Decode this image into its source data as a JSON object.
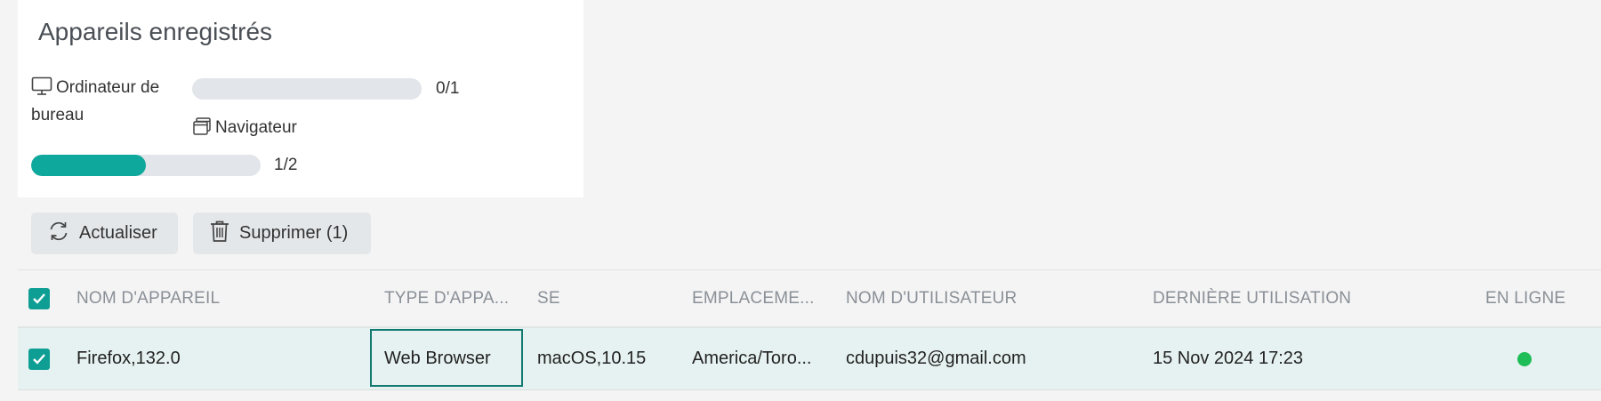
{
  "summary": {
    "title": "Appareils enregistrés",
    "desktop": {
      "label_line1": "Ordinateur de",
      "label_line2": "bureau",
      "count": "0/1",
      "progress": 0.0,
      "icon": "monitor-icon"
    },
    "browser": {
      "label": "Navigateur",
      "count": "1/2",
      "progress": 0.5,
      "icon": "browser-windows-icon"
    }
  },
  "toolbar": {
    "refresh_label": "Actualiser",
    "delete_label": "Supprimer (1)"
  },
  "table": {
    "columns": [
      "NOM D'APPAREIL",
      "TYPE D'APPA...",
      "SE",
      "EMPLACEME...",
      "NOM D'UTILISATEUR",
      "DERNIÈRE UTILISATION",
      "EN LIGNE"
    ],
    "rows": [
      {
        "checked": true,
        "device_name": "Firefox,132.0",
        "device_type": "Web Browser",
        "os": "macOS,10.15",
        "location": "America/Toro...",
        "username": "cdupuis32@gmail.com",
        "last_used": "15 Nov 2024 17:23",
        "online": true
      }
    ]
  },
  "colors": {
    "accent": "#0fa89c",
    "online": "#1fbd57",
    "row_selected": "#e6f2f1"
  }
}
